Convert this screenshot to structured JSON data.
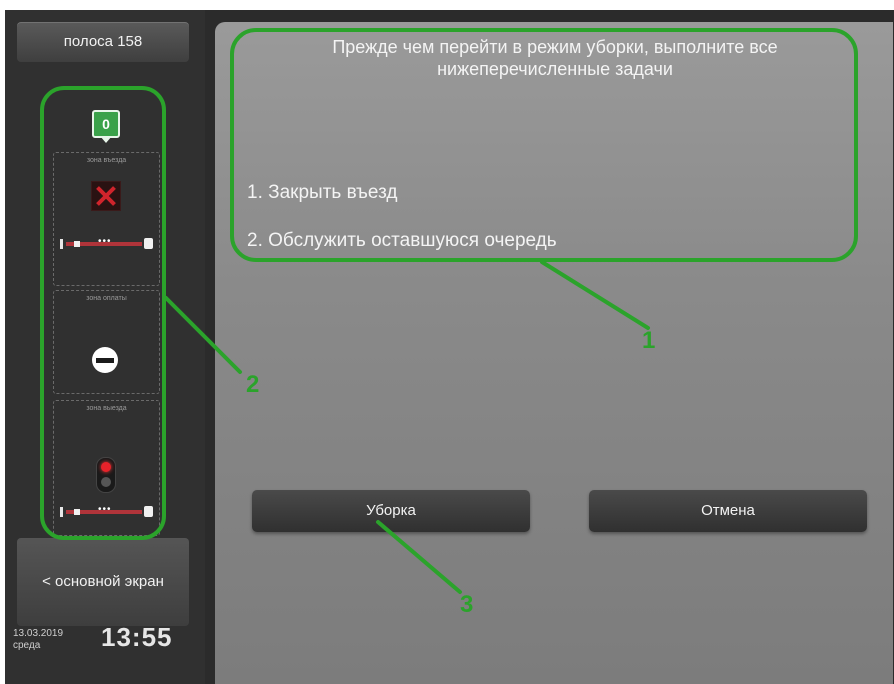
{
  "sidebar": {
    "lane_button": "полоса 158",
    "counter": "0",
    "zones": {
      "entry": "зона въезда",
      "payment": "зона оплаты",
      "exit": "зона выезда"
    },
    "main_screen_button": "< основной экран",
    "date": "13.03.2019",
    "weekday": "среда",
    "time": "13:55"
  },
  "main": {
    "message": "Прежде чем перейти в режим уборки, выполните все нижеперечисленные задачи",
    "tasks": [
      "1. Закрыть въезд",
      "2. Обслужить оставшуюся очередь"
    ],
    "buttons": {
      "clean": "Уборка",
      "cancel": "Отмена"
    }
  },
  "annotations": [
    "1",
    "2",
    "3"
  ],
  "colors": {
    "annotation": "#2ba32b",
    "barrier": "#b0343a",
    "counter": "#3aa24a",
    "signal_red": "#e8222a"
  },
  "icons": [
    "cross-icon",
    "no-entry-icon",
    "traffic-light-icon",
    "barrier-icon"
  ]
}
